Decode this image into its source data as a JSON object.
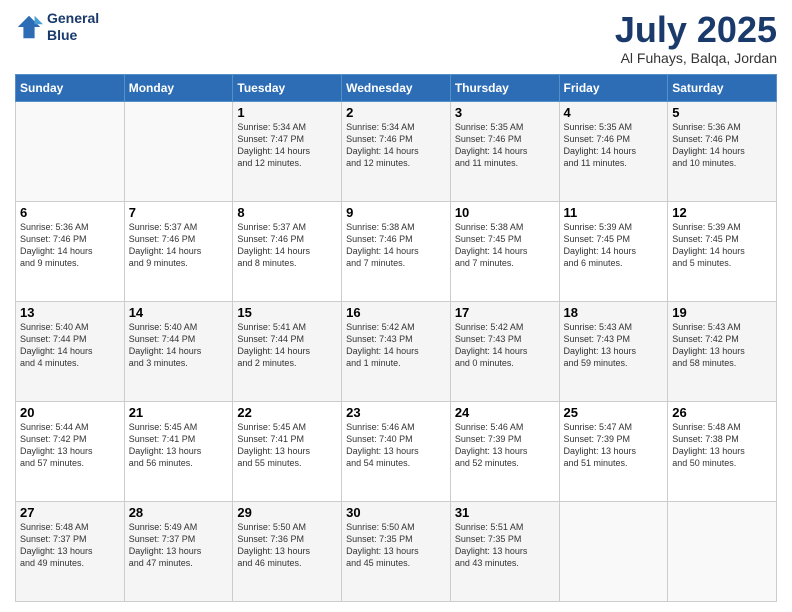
{
  "header": {
    "logo_line1": "General",
    "logo_line2": "Blue",
    "month": "July 2025",
    "location": "Al Fuhays, Balqa, Jordan"
  },
  "weekdays": [
    "Sunday",
    "Monday",
    "Tuesday",
    "Wednesday",
    "Thursday",
    "Friday",
    "Saturday"
  ],
  "weeks": [
    [
      {
        "day": "",
        "info": ""
      },
      {
        "day": "",
        "info": ""
      },
      {
        "day": "1",
        "info": "Sunrise: 5:34 AM\nSunset: 7:47 PM\nDaylight: 14 hours\nand 12 minutes."
      },
      {
        "day": "2",
        "info": "Sunrise: 5:34 AM\nSunset: 7:46 PM\nDaylight: 14 hours\nand 12 minutes."
      },
      {
        "day": "3",
        "info": "Sunrise: 5:35 AM\nSunset: 7:46 PM\nDaylight: 14 hours\nand 11 minutes."
      },
      {
        "day": "4",
        "info": "Sunrise: 5:35 AM\nSunset: 7:46 PM\nDaylight: 14 hours\nand 11 minutes."
      },
      {
        "day": "5",
        "info": "Sunrise: 5:36 AM\nSunset: 7:46 PM\nDaylight: 14 hours\nand 10 minutes."
      }
    ],
    [
      {
        "day": "6",
        "info": "Sunrise: 5:36 AM\nSunset: 7:46 PM\nDaylight: 14 hours\nand 9 minutes."
      },
      {
        "day": "7",
        "info": "Sunrise: 5:37 AM\nSunset: 7:46 PM\nDaylight: 14 hours\nand 9 minutes."
      },
      {
        "day": "8",
        "info": "Sunrise: 5:37 AM\nSunset: 7:46 PM\nDaylight: 14 hours\nand 8 minutes."
      },
      {
        "day": "9",
        "info": "Sunrise: 5:38 AM\nSunset: 7:46 PM\nDaylight: 14 hours\nand 7 minutes."
      },
      {
        "day": "10",
        "info": "Sunrise: 5:38 AM\nSunset: 7:45 PM\nDaylight: 14 hours\nand 7 minutes."
      },
      {
        "day": "11",
        "info": "Sunrise: 5:39 AM\nSunset: 7:45 PM\nDaylight: 14 hours\nand 6 minutes."
      },
      {
        "day": "12",
        "info": "Sunrise: 5:39 AM\nSunset: 7:45 PM\nDaylight: 14 hours\nand 5 minutes."
      }
    ],
    [
      {
        "day": "13",
        "info": "Sunrise: 5:40 AM\nSunset: 7:44 PM\nDaylight: 14 hours\nand 4 minutes."
      },
      {
        "day": "14",
        "info": "Sunrise: 5:40 AM\nSunset: 7:44 PM\nDaylight: 14 hours\nand 3 minutes."
      },
      {
        "day": "15",
        "info": "Sunrise: 5:41 AM\nSunset: 7:44 PM\nDaylight: 14 hours\nand 2 minutes."
      },
      {
        "day": "16",
        "info": "Sunrise: 5:42 AM\nSunset: 7:43 PM\nDaylight: 14 hours\nand 1 minute."
      },
      {
        "day": "17",
        "info": "Sunrise: 5:42 AM\nSunset: 7:43 PM\nDaylight: 14 hours\nand 0 minutes."
      },
      {
        "day": "18",
        "info": "Sunrise: 5:43 AM\nSunset: 7:43 PM\nDaylight: 13 hours\nand 59 minutes."
      },
      {
        "day": "19",
        "info": "Sunrise: 5:43 AM\nSunset: 7:42 PM\nDaylight: 13 hours\nand 58 minutes."
      }
    ],
    [
      {
        "day": "20",
        "info": "Sunrise: 5:44 AM\nSunset: 7:42 PM\nDaylight: 13 hours\nand 57 minutes."
      },
      {
        "day": "21",
        "info": "Sunrise: 5:45 AM\nSunset: 7:41 PM\nDaylight: 13 hours\nand 56 minutes."
      },
      {
        "day": "22",
        "info": "Sunrise: 5:45 AM\nSunset: 7:41 PM\nDaylight: 13 hours\nand 55 minutes."
      },
      {
        "day": "23",
        "info": "Sunrise: 5:46 AM\nSunset: 7:40 PM\nDaylight: 13 hours\nand 54 minutes."
      },
      {
        "day": "24",
        "info": "Sunrise: 5:46 AM\nSunset: 7:39 PM\nDaylight: 13 hours\nand 52 minutes."
      },
      {
        "day": "25",
        "info": "Sunrise: 5:47 AM\nSunset: 7:39 PM\nDaylight: 13 hours\nand 51 minutes."
      },
      {
        "day": "26",
        "info": "Sunrise: 5:48 AM\nSunset: 7:38 PM\nDaylight: 13 hours\nand 50 minutes."
      }
    ],
    [
      {
        "day": "27",
        "info": "Sunrise: 5:48 AM\nSunset: 7:37 PM\nDaylight: 13 hours\nand 49 minutes."
      },
      {
        "day": "28",
        "info": "Sunrise: 5:49 AM\nSunset: 7:37 PM\nDaylight: 13 hours\nand 47 minutes."
      },
      {
        "day": "29",
        "info": "Sunrise: 5:50 AM\nSunset: 7:36 PM\nDaylight: 13 hours\nand 46 minutes."
      },
      {
        "day": "30",
        "info": "Sunrise: 5:50 AM\nSunset: 7:35 PM\nDaylight: 13 hours\nand 45 minutes."
      },
      {
        "day": "31",
        "info": "Sunrise: 5:51 AM\nSunset: 7:35 PM\nDaylight: 13 hours\nand 43 minutes."
      },
      {
        "day": "",
        "info": ""
      },
      {
        "day": "",
        "info": ""
      }
    ]
  ]
}
